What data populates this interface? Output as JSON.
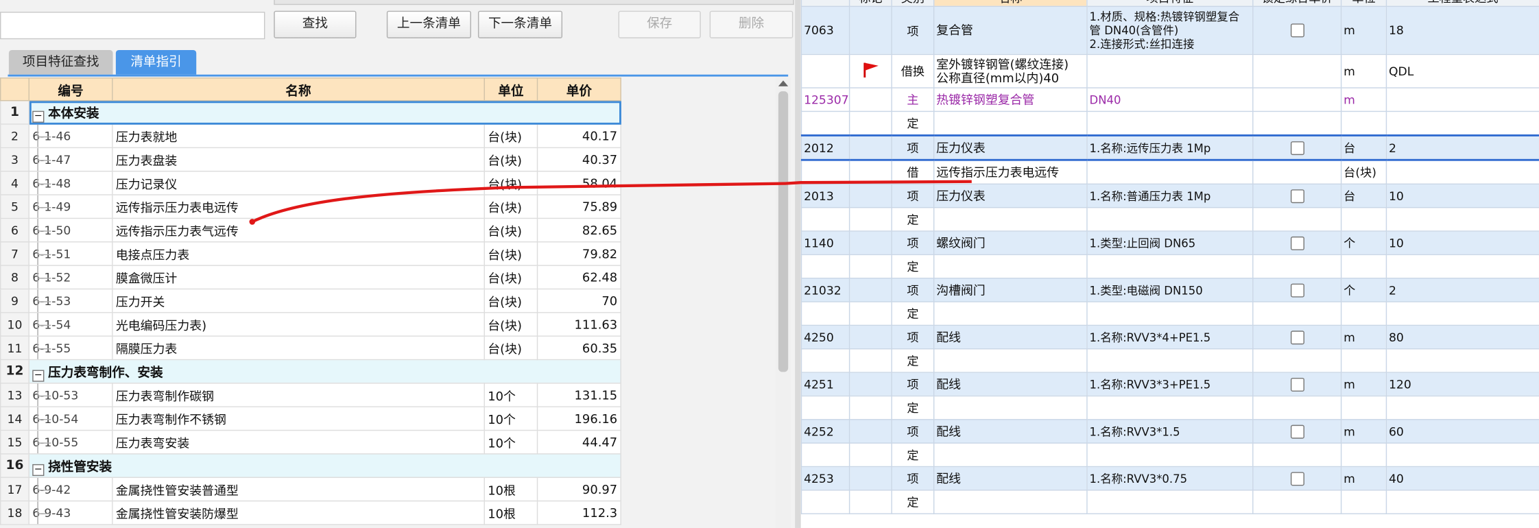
{
  "toolbar": {
    "find": "查找",
    "prev": "上一条清单",
    "next": "下一条清单",
    "save": "保存",
    "delete": "删除"
  },
  "tabs": [
    "项目特征查找",
    "清单指引"
  ],
  "left_table": {
    "headers": [
      "编号",
      "名称",
      "单位",
      "单价"
    ],
    "rows": [
      {
        "no": "1",
        "type": "group",
        "expander": "−",
        "name": "本体安装"
      },
      {
        "no": "2",
        "code": "6-1-46",
        "name": "压力表就地",
        "unit": "台(块)",
        "price": "40.17"
      },
      {
        "no": "3",
        "code": "6-1-47",
        "name": "压力表盘装",
        "unit": "台(块)",
        "price": "40.37"
      },
      {
        "no": "4",
        "code": "6-1-48",
        "name": "压力记录仪",
        "unit": "台(块)",
        "price": "58.04"
      },
      {
        "no": "5",
        "code": "6-1-49",
        "name": "远传指示压力表电远传",
        "unit": "台(块)",
        "price": "75.89"
      },
      {
        "no": "6",
        "code": "6-1-50",
        "name": "远传指示压力表气远传",
        "unit": "台(块)",
        "price": "82.65"
      },
      {
        "no": "7",
        "code": "6-1-51",
        "name": "电接点压力表",
        "unit": "台(块)",
        "price": "79.82"
      },
      {
        "no": "8",
        "code": "6-1-52",
        "name": "膜盒微压计",
        "unit": "台(块)",
        "price": "62.48"
      },
      {
        "no": "9",
        "code": "6-1-53",
        "name": "压力开关",
        "unit": "台(块)",
        "price": "70"
      },
      {
        "no": "10",
        "code": "6-1-54",
        "name": "光电编码压力表)",
        "unit": "台(块)",
        "price": "111.63"
      },
      {
        "no": "11",
        "code": "6-1-55",
        "name": "隔膜压力表",
        "unit": "台(块)",
        "price": "60.35"
      },
      {
        "no": "12",
        "type": "group",
        "expander": "−",
        "name": "压力表弯制作、安装"
      },
      {
        "no": "13",
        "code": "6-10-53",
        "name": "压力表弯制作碳钢",
        "unit": "10个",
        "price": "131.15"
      },
      {
        "no": "14",
        "code": "6-10-54",
        "name": "压力表弯制作不锈钢",
        "unit": "10个",
        "price": "196.16"
      },
      {
        "no": "15",
        "code": "6-10-55",
        "name": "压力表弯安装",
        "unit": "10个",
        "price": "44.47"
      },
      {
        "no": "16",
        "type": "group",
        "expander": "−",
        "name": "挠性管安装"
      },
      {
        "no": "17",
        "code": "6-9-42",
        "name": "金属挠性管安装普通型",
        "unit": "10根",
        "price": "90.97"
      },
      {
        "no": "18",
        "code": "6-9-43",
        "name": "金属挠性管安装防爆型",
        "unit": "10根",
        "price": "112.3"
      }
    ]
  },
  "right_table": {
    "headers": [
      "标记",
      "类别",
      "名称",
      "项目特征",
      "锁定综合单价",
      "单位",
      "工程量表达式"
    ],
    "rows": [
      {
        "code": "7063",
        "mark": "",
        "type": "项",
        "name": "复合管",
        "features": "1.材质、规格:热镀锌钢塑复合管 DN40(含管件)\n2.连接形式:丝扣连接",
        "lock": true,
        "unit": "m",
        "qty": "18",
        "style": "xiang tall"
      },
      {
        "code": "",
        "mark": "flag",
        "type": "借换",
        "name": "室外镀锌钢管(螺纹连接)\n公称直径(mm以内)40",
        "features": "",
        "lock": false,
        "unit": "m",
        "qty": "QDL",
        "style": "mid"
      },
      {
        "code": "125307",
        "mark": "",
        "type": "主",
        "name": "热镀锌钢塑复合管",
        "features": "DN40",
        "lock": false,
        "unit": "m",
        "qty": "",
        "style": "purple"
      },
      {
        "code": "",
        "mark": "",
        "type": "定",
        "name": "",
        "features": "",
        "lock": false,
        "unit": "",
        "qty": "",
        "style": ""
      },
      {
        "code": "2012",
        "mark": "",
        "type": "项",
        "name": "压力仪表",
        "features": "1.名称:远传压力表 1Mp",
        "lock": true,
        "unit": "台",
        "qty": "2",
        "style": "xiang selrow"
      },
      {
        "code": "",
        "mark": "",
        "type": "借",
        "name": "远传指示压力表电远传",
        "features": "",
        "lock": false,
        "unit": "台(块)",
        "qty": "",
        "style": ""
      },
      {
        "code": "2013",
        "mark": "",
        "type": "项",
        "name": "压力仪表",
        "features": "1.名称:普通压力表 1Mp",
        "lock": true,
        "unit": "台",
        "qty": "10",
        "style": "xiang"
      },
      {
        "code": "",
        "mark": "",
        "type": "定",
        "name": "",
        "features": "",
        "lock": false,
        "unit": "",
        "qty": "",
        "style": ""
      },
      {
        "code": "1140",
        "mark": "",
        "type": "项",
        "name": "螺纹阀门",
        "features": "1.类型:止回阀 DN65",
        "lock": true,
        "unit": "个",
        "qty": "10",
        "style": "xiang"
      },
      {
        "code": "",
        "mark": "",
        "type": "定",
        "name": "",
        "features": "",
        "lock": false,
        "unit": "",
        "qty": "",
        "style": ""
      },
      {
        "code": "21032",
        "mark": "",
        "type": "项",
        "name": "沟槽阀门",
        "features": "1.类型:电磁阀 DN150",
        "lock": true,
        "unit": "个",
        "qty": "2",
        "style": "xiang"
      },
      {
        "code": "",
        "mark": "",
        "type": "定",
        "name": "",
        "features": "",
        "lock": false,
        "unit": "",
        "qty": "",
        "style": ""
      },
      {
        "code": "4250",
        "mark": "",
        "type": "项",
        "name": "配线",
        "features": "1.名称:RVV3*4+PE1.5",
        "lock": true,
        "unit": "m",
        "qty": "80",
        "style": "xiang"
      },
      {
        "code": "",
        "mark": "",
        "type": "定",
        "name": "",
        "features": "",
        "lock": false,
        "unit": "",
        "qty": "",
        "style": ""
      },
      {
        "code": "4251",
        "mark": "",
        "type": "项",
        "name": "配线",
        "features": "1.名称:RVV3*3+PE1.5",
        "lock": true,
        "unit": "m",
        "qty": "120",
        "style": "xiang"
      },
      {
        "code": "",
        "mark": "",
        "type": "定",
        "name": "",
        "features": "",
        "lock": false,
        "unit": "",
        "qty": "",
        "style": ""
      },
      {
        "code": "4252",
        "mark": "",
        "type": "项",
        "name": "配线",
        "features": "1.名称:RVV3*1.5",
        "lock": true,
        "unit": "m",
        "qty": "60",
        "style": "xiang"
      },
      {
        "code": "",
        "mark": "",
        "type": "定",
        "name": "",
        "features": "",
        "lock": false,
        "unit": "",
        "qty": "",
        "style": ""
      },
      {
        "code": "4253",
        "mark": "",
        "type": "项",
        "name": "配线",
        "features": "1.名称:RVV3*0.75",
        "lock": true,
        "unit": "m",
        "qty": "40",
        "style": "xiang"
      },
      {
        "code": "",
        "mark": "",
        "type": "定",
        "name": "",
        "features": "",
        "lock": false,
        "unit": "",
        "qty": "",
        "style": ""
      }
    ]
  },
  "colors": {
    "tab_active": "#4a96e8",
    "header_bg": "#fde4bf",
    "group_bg": "#e6f7fb",
    "row_xiang": "#deebf9",
    "annotation": "#e01818"
  },
  "icons": {
    "flag": "flag-icon",
    "expander": "collapse-icon"
  }
}
